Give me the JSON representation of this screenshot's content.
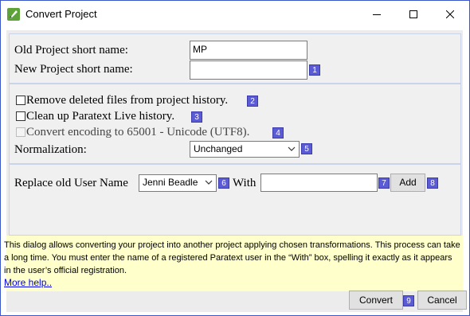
{
  "window": {
    "title": "Convert Project",
    "controls": {
      "minimize": "minimize",
      "maximize": "maximize",
      "close": "close"
    }
  },
  "project": {
    "old_label": "Old Project short name:",
    "old_value": "MP",
    "new_label": "New Project short name:",
    "new_value": "",
    "badge_new": "1"
  },
  "options": {
    "remove_deleted": {
      "label": "Remove deleted files from project history.",
      "badge": "2",
      "checked": false
    },
    "cleanup_live": {
      "label": "Clean up Paratext Live history.",
      "badge": "3",
      "checked": false
    },
    "convert_encoding": {
      "label": "Convert encoding to 65001 - Unicode (UTF8).",
      "badge": "4",
      "checked": false
    },
    "normalization_label": "Normalization:",
    "normalization_value": "Unchanged",
    "badge_norm": "5"
  },
  "users": {
    "replace_label": "Replace old User Name",
    "old_user_value": "Jenni Beadle",
    "badge_user": "6",
    "with_label": "With",
    "with_value": "",
    "badge_with": "7",
    "add_label": "Add",
    "badge_add": "8"
  },
  "help": {
    "text": "This dialog allows converting your project into another project applying chosen transformations. This process can take a long time. You must enter the name of a registered Paratext user in the “With” box, spelling it exactly as it appears in the user’s official registration.",
    "link": "More help.."
  },
  "footer": {
    "convert_label": "Convert",
    "badge_convert": "9",
    "cancel_label": "Cancel"
  },
  "colors": {
    "frame": "#3c57c8",
    "badge": "#5b5bd6",
    "help_bg": "#ffffcc",
    "link": "#0000ee"
  }
}
